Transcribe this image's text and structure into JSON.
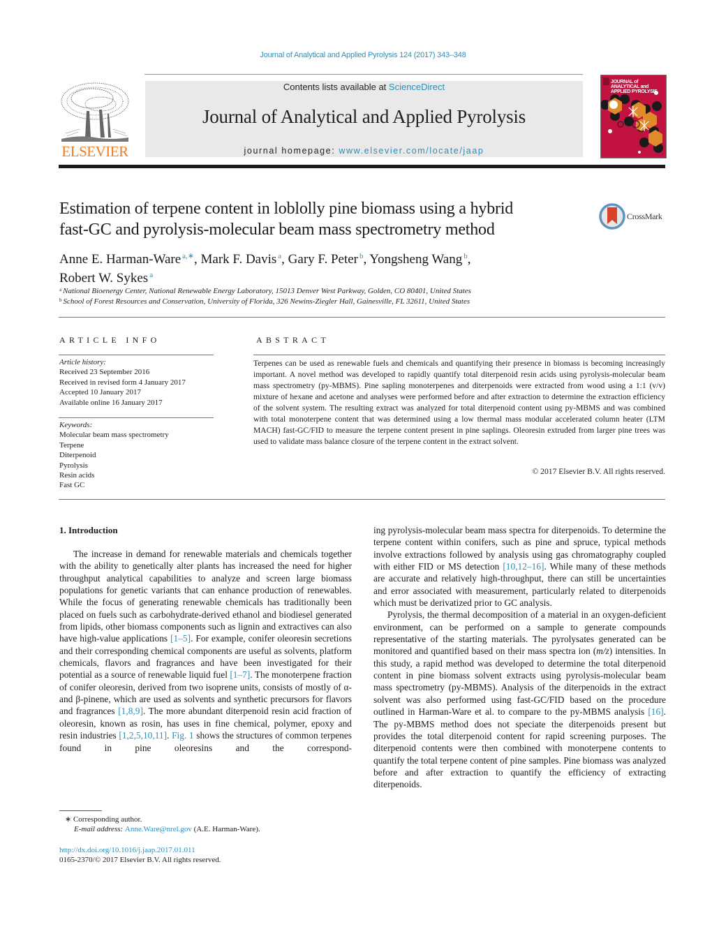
{
  "header": {
    "citation": "Journal of Analytical and Applied Pyrolysis 124 (2017) 343–348",
    "contents_prefix": "Contents lists available at ",
    "contents_link": "ScienceDirect",
    "journal_name": "Journal of Analytical and Applied Pyrolysis",
    "homepage_prefix": "journal homepage: ",
    "homepage_link": "www.elsevier.com/locate/jaap",
    "publisher_logo_text": "ELSEVIER",
    "cover_title_lines": [
      "JOURNAL of",
      "ANALYTICAL and",
      "APPLIED PYROLYSIS"
    ],
    "colors": {
      "link": "#2a8fb8",
      "publisher_orange": "#f07c1e",
      "cover_red": "#c2123f",
      "cover_orange": "#e08a2c",
      "masthead_gray": "#e9e9e9"
    }
  },
  "article": {
    "title_line1": "Estimation of terpene content in loblolly pine biomass using a hybrid",
    "title_line2": "fast-GC and pyrolysis-molecular beam mass spectrometry method",
    "crossmark_label": "CrossMark",
    "authors": [
      {
        "name": "Anne E. Harman-Ware",
        "affil": "a,∗",
        "sep": ", "
      },
      {
        "name": "Mark F. Davis",
        "affil": "a",
        "sep": ", "
      },
      {
        "name": "Gary F. Peter",
        "affil": "b",
        "sep": ", "
      },
      {
        "name": "Yongsheng Wang",
        "affil": "b",
        "sep": ","
      },
      {
        "name": "Robert W. Sykes",
        "affil": "a",
        "sep": ""
      }
    ],
    "affiliations": [
      {
        "mark": "a",
        "text": "National Bioenergy Center, National Renewable Energy Laboratory, 15013 Denver West Parkway, Golden, CO 80401, United States"
      },
      {
        "mark": "b",
        "text": "School of Forest Resources and Conservation, University of Florida, 326 Newins-Ziegler Hall, Gainesville, FL 32611, United States"
      }
    ]
  },
  "article_info": {
    "heading": "ARTICLE INFO",
    "history_label": "Article history:",
    "history": [
      "Received 23 September 2016",
      "Received in revised form 4 January 2017",
      "Accepted 10 January 2017",
      "Available online 16 January 2017"
    ],
    "keywords_label": "Keywords:",
    "keywords": [
      "Molecular beam mass spectrometry",
      "Terpene",
      "Diterpenoid",
      "Pyrolysis",
      "Resin acids",
      "Fast GC"
    ]
  },
  "abstract": {
    "heading": "ABSTRACT",
    "text": "Terpenes can be used as renewable fuels and chemicals and quantifying their presence in biomass is becoming increasingly important. A novel method was developed to rapidly quantify total diterpenoid resin acids using pyrolysis-molecular beam mass spectrometry (py-MBMS). Pine sapling monoterpenes and diterpenoids were extracted from wood using a 1:1 (v/v) mixture of hexane and acetone and analyses were performed before and after extraction to determine the extraction efficiency of the solvent system. The resulting extract was analyzed for total diterpenoid content using py-MBMS and was combined with total monoterpene content that was determined using a low thermal mass modular accelerated column heater (LTM MACH) fast-GC/FID to measure the terpene content present in pine saplings. Oleoresin extruded from larger pine trees was used to validate mass balance closure of the terpene content in the extract solvent.",
    "copyright": "© 2017 Elsevier B.V. All rights reserved."
  },
  "introduction": {
    "heading": "1.  Introduction",
    "para1": [
      {
        "t": "The increase in demand for renewable materials and chemicals together with the ability to genetically alter plants has increased the need for higher throughput analytical capabilities to analyze and screen large biomass populations for genetic variants that can enhance production of renewables. While the focus of generating renewable chemicals has traditionally been placed on fuels such as carbohydrate-derived ethanol and biodiesel generated from lipids, other biomass components such as lignin and extractives can also have high-value applications "
      },
      {
        "ref": "[1–5]"
      },
      {
        "t": ". For example, conifer oleoresin secretions and their corresponding chemical components are useful as solvents, platform chemicals, flavors and fragrances and have been investigated for their potential as a source of renewable liquid fuel "
      },
      {
        "ref": "[1–7]"
      },
      {
        "t": ". The monoterpene fraction of conifer oleoresin, derived from two isoprene units, consists of mostly of α- and β-pinene, which are used as solvents and synthetic precursors for flavors and fragrances "
      },
      {
        "ref": "[1,8,9]"
      },
      {
        "t": ". The more abundant diterpenoid resin acid fraction of oleoresin, known as rosin, has uses in fine chemical, polymer, epoxy and resin industries "
      },
      {
        "ref": "[1,2,5,10,11]"
      },
      {
        "t": ". "
      },
      {
        "ref": "Fig. 1"
      },
      {
        "t": " shows the structures of common terpenes found in pine oleoresins and the corresponding pyrolysis-molecular beam mass spectra for diterpenoids. To determine the terpene content within conifers, such as pine and spruce, typical methods involve extractions followed by analysis using gas chromatography coupled with either FID or MS detection "
      },
      {
        "ref": "[10,12–16]"
      },
      {
        "t": ". While many of these methods are accurate and relatively high-throughput, there can still be uncertainties and error associated with measurement, particularly related to diterpenoids which must be derivatized prior to GC analysis."
      }
    ],
    "para2": [
      {
        "t": "Pyrolysis, the thermal decomposition of a material in an oxygen-deficient environment, can be performed on a sample to generate compounds representative of the starting materials. The pyrolysates generated can be monitored and quantified based on their mass spectra ion ("
      },
      {
        "it": "m/z"
      },
      {
        "t": ") intensities. In this study, a rapid method was developed to determine the total diterpenoid content in pine biomass solvent extracts using pyrolysis-molecular beam mass spectrometry (py-MBMS). Analysis of the diterpenoids in the extract solvent was also performed using fast-GC/FID based on the procedure outlined in Harman-Ware et al. to compare to the py-MBMS analysis "
      },
      {
        "ref": "[16]"
      },
      {
        "t": ". The py-MBMS method does not speciate the diterpenoids present but provides the total diterpenoid content for rapid screening purposes. The diterpenoid contents were then combined with monoterpene contents to quantify the total terpene content of pine samples. Pine biomass was analyzed before and after extraction to quantify the efficiency of extracting diterpenoids."
      }
    ]
  },
  "footnotes": {
    "corresponding": "∗  Corresponding author.",
    "email_label": "E-mail address: ",
    "email": "Anne.Ware@nrel.gov",
    "email_suffix": " (A.E. Harman-Ware).",
    "doi": "http://dx.doi.org/10.1016/j.jaap.2017.01.011",
    "issn": "0165-2370/© 2017 Elsevier B.V. All rights reserved."
  }
}
